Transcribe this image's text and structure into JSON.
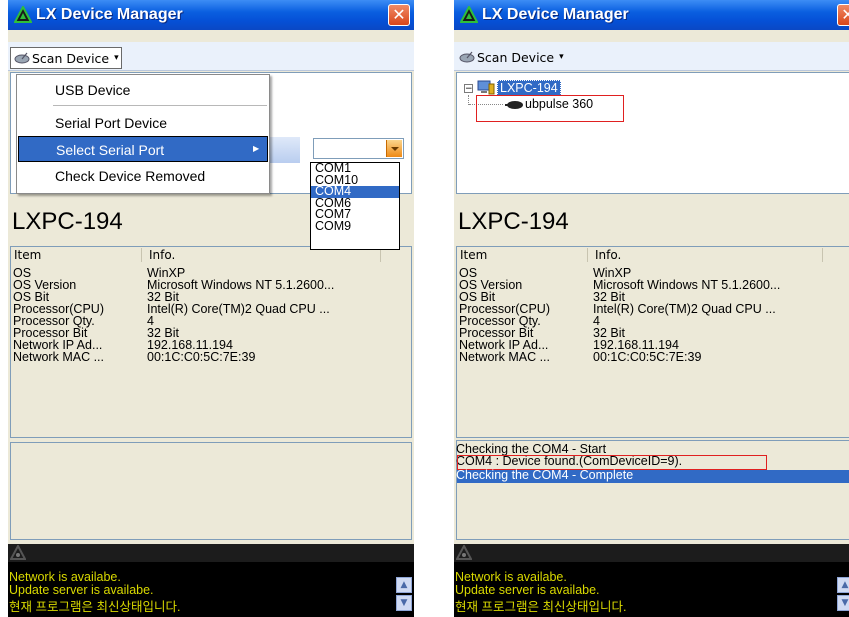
{
  "app": {
    "title": "LX Device Manager"
  },
  "toolbar": {
    "scan_label": "Scan Device"
  },
  "menu": {
    "items": [
      "USB Device",
      "Serial Port Device",
      "Select Serial Port",
      "Check Device Removed"
    ]
  },
  "serial_ports": [
    "COM1",
    "COM10",
    "COM4",
    "COM6",
    "COM7",
    "COM9"
  ],
  "serial_port_selected": "COM4",
  "tree": {
    "root": "LXPC-194",
    "child": "ubpulse 360"
  },
  "hostname": "LXPC-194",
  "table": {
    "headers": [
      "Item",
      "Info."
    ],
    "rows": [
      {
        "key": "OS",
        "value": "WinXP"
      },
      {
        "key": "OS Version",
        "value": "Microsoft Windows NT 5.1.2600..."
      },
      {
        "key": "OS Bit",
        "value": "32 Bit"
      },
      {
        "key": "Processor(CPU)",
        "value": "Intel(R) Core(TM)2 Quad CPU ..."
      },
      {
        "key": "Processor Qty.",
        "value": "4"
      },
      {
        "key": "Processor Bit",
        "value": "32 Bit"
      },
      {
        "key": "Network IP Ad...",
        "value": "192.168.11.194"
      },
      {
        "key": "Network MAC ...",
        "value": "00:1C:C0:5C:7E:39"
      }
    ]
  },
  "log": {
    "line1": "Checking the COM4 - Start",
    "line2": "COM4     : Device found.(ComDeviceID=9).",
    "line3": "Checking the COM4 - Complete"
  },
  "status": {
    "line1": "Network is availabe.",
    "line2": "Update server is availabe.",
    "line3": "현재 프로그램은 최신상태입니다."
  },
  "colors": {
    "selection": "#316ac5",
    "status_text": "#d9d900",
    "titlebar": "#0550d6",
    "highlight_box": "#e02020"
  }
}
